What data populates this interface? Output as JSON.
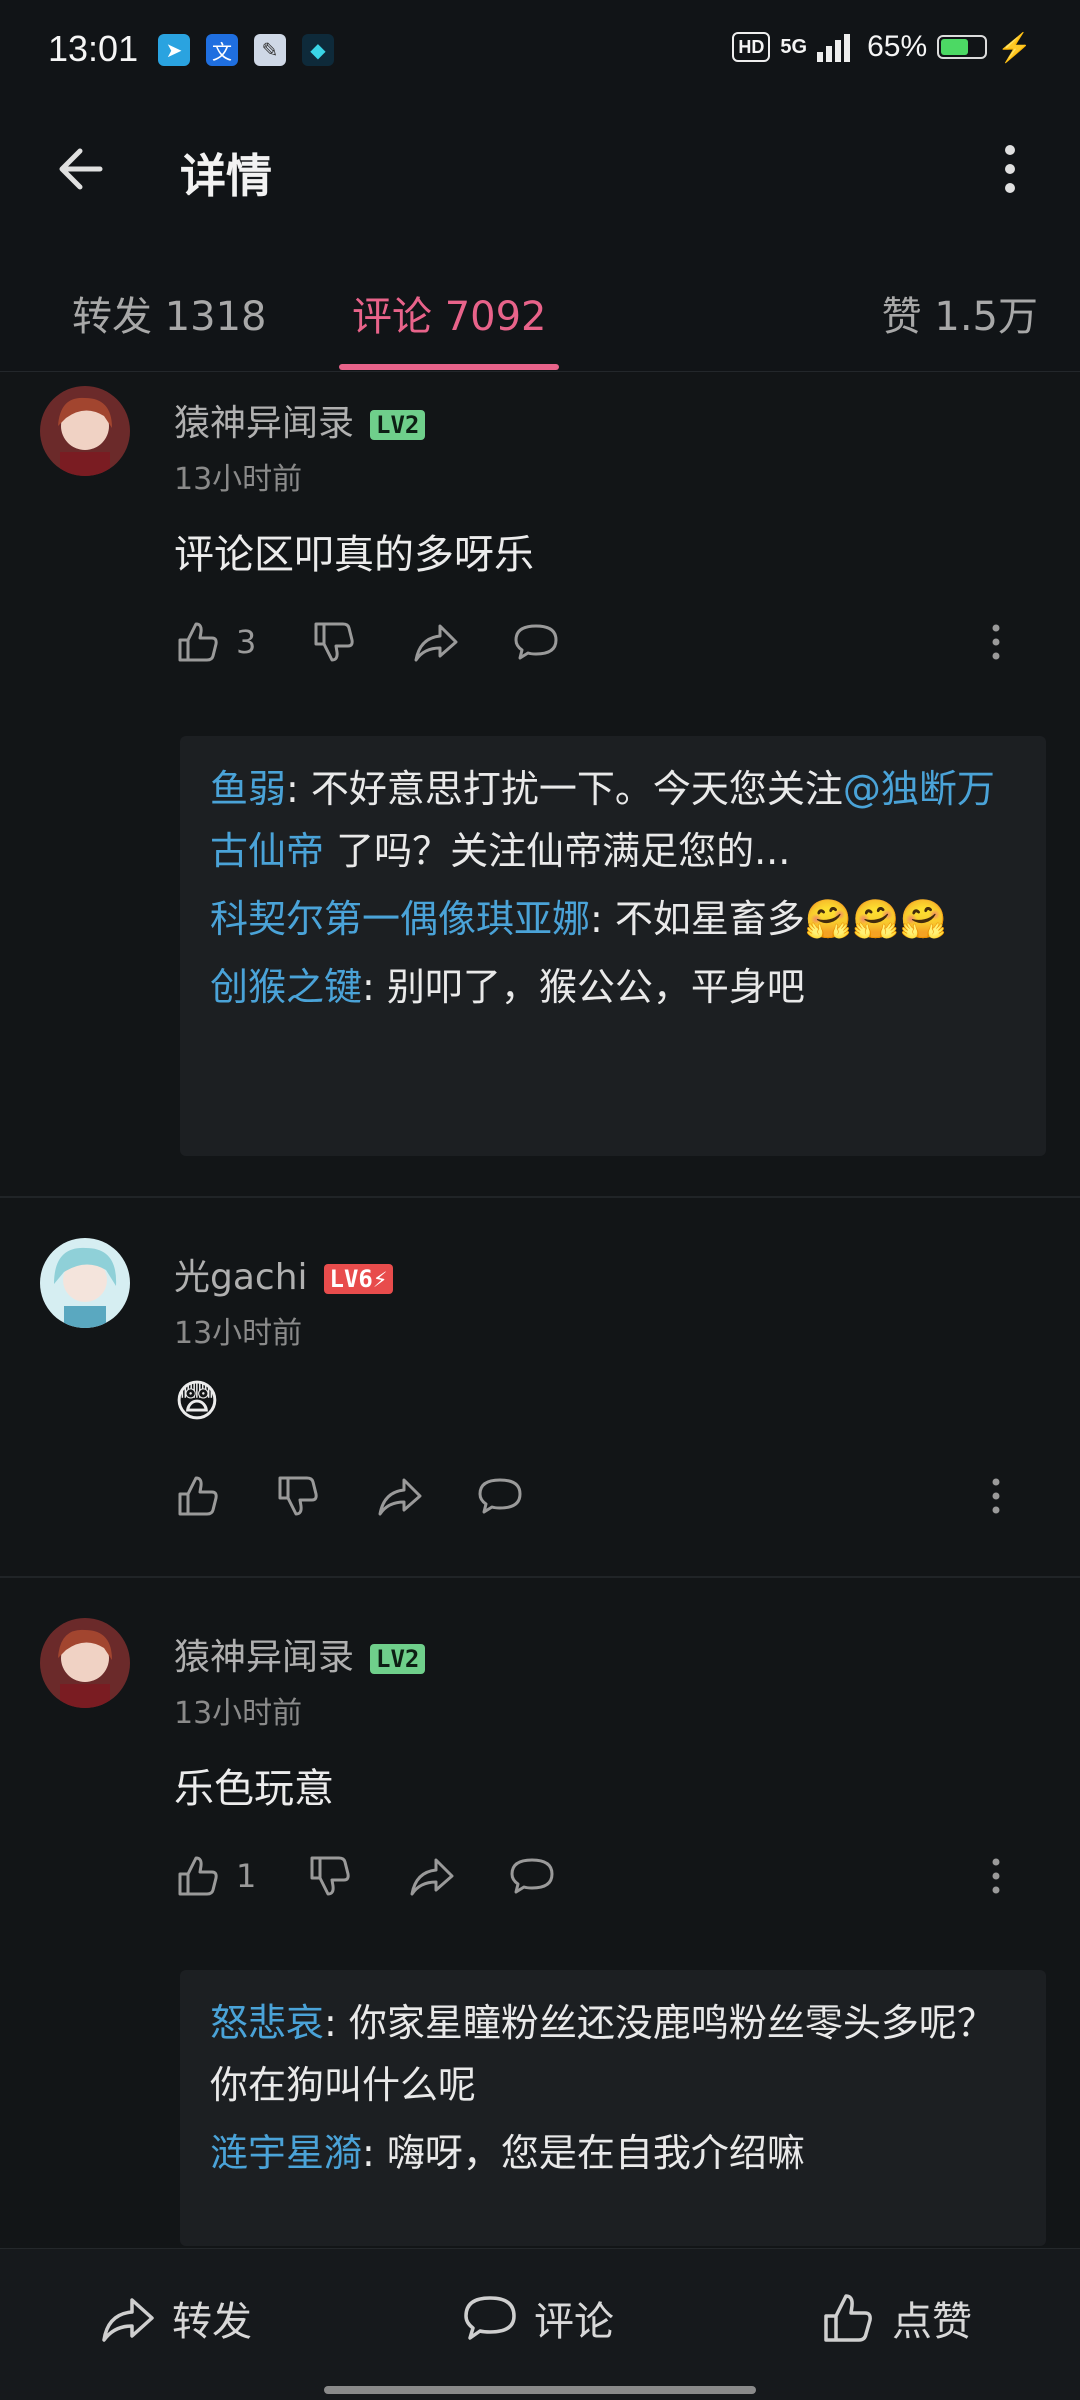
{
  "status_bar": {
    "time": "13:01",
    "hd": "HD",
    "network": "5G",
    "battery": "65%",
    "battery_level": 0.65,
    "apps": [
      "telegram-icon",
      "translate-icon",
      "notes-icon",
      "shield-app-icon"
    ]
  },
  "header": {
    "title": "详情"
  },
  "tabs": [
    {
      "label": "转发 1318"
    },
    {
      "label": "评论 7092"
    },
    {
      "label": "赞 1.5万"
    }
  ],
  "comments": [
    {
      "username": "猿神异闻录",
      "level": "LV2",
      "time": "13小时前",
      "content": "评论区叩真的多呀乐",
      "likes": "3",
      "replies": [
        {
          "user": "鱼弱",
          "sep": ": ",
          "text": "不好意思打扰一下。今天您关注",
          "mention": "@独断万古仙帝",
          "text2": " 了吗？关注仙帝满足您的..."
        },
        {
          "user": "科契尔第一偶像琪亚娜",
          "sep": ": ",
          "text": "不如星畜多🤗🤗🤗"
        },
        {
          "user": "创猴之键",
          "sep": ": ",
          "text": "别叩了，猴公公，平身吧"
        }
      ]
    },
    {
      "username": "光gachi",
      "level": "LV6⚡",
      "time": "13小时前",
      "content": "😨",
      "likes": ""
    },
    {
      "username": "猿神异闻录",
      "level": "LV2",
      "time": "13小时前",
      "content": "乐色玩意",
      "likes": "1",
      "replies": [
        {
          "user": "怒悲哀",
          "sep": ": ",
          "text": "你家星瞳粉丝还没鹿鸣粉丝零头多呢？你在狗叫什么呢"
        },
        {
          "user": "涟宇星漪",
          "sep": ": ",
          "text": "嗨呀，您是在自我介绍嘛"
        }
      ]
    }
  ],
  "bottom_bar": {
    "repost": "转发",
    "comment": "评论",
    "like": "点赞"
  },
  "colors": {
    "accent": "#e8638a",
    "link": "#4aa3d8",
    "background": "#121517"
  }
}
